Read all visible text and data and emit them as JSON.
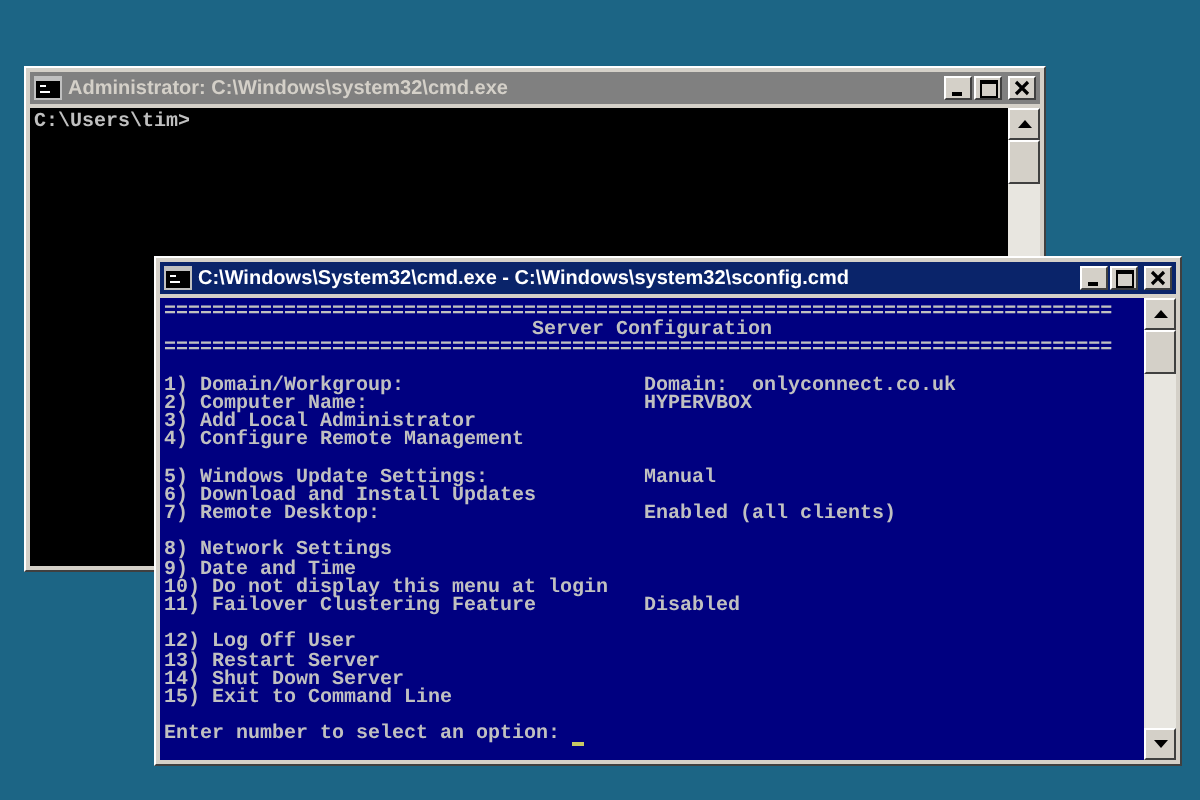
{
  "windows": [
    {
      "title": "Administrator: C:\\Windows\\system32\\cmd.exe",
      "active": false,
      "groups": [
        [
          {
            "label": "C:\\Users\\tim>"
          }
        ]
      ]
    },
    {
      "title": "C:\\Windows\\System32\\cmd.exe - C:\\Windows\\system32\\sconfig.cmd",
      "active": true,
      "header": [
        "===============================================================================",
        "Server Configuration",
        "==============================================================================="
      ],
      "groups": [
        [
          {
            "label": "1) Domain/Workgroup:",
            "value": "Domain:  onlyconnect.co.uk"
          },
          {
            "label": "2) Computer Name:",
            "value": "HYPERVBOX"
          },
          {
            "label": "3) Add Local Administrator"
          },
          {
            "label": "4) Configure Remote Management"
          }
        ],
        [
          {
            "label": "5) Windows Update Settings:",
            "value": "Manual"
          },
          {
            "label": "6) Download and Install Updates"
          },
          {
            "label": "7) Remote Desktop:",
            "value": "Enabled (all clients)"
          }
        ],
        [
          {
            "label": "8) Network Settings"
          },
          {
            "label": "9) Date and Time"
          },
          {
            "label": "10) Do not display this menu at login"
          },
          {
            "label": "11) Failover Clustering Feature",
            "value": "Disabled"
          }
        ],
        [
          {
            "label": "12) Log Off User"
          },
          {
            "label": "13) Restart Server"
          },
          {
            "label": "14) Shut Down Server"
          },
          {
            "label": "15) Exit to Command Line"
          }
        ]
      ],
      "prompt": "Enter number to select an option:"
    }
  ]
}
